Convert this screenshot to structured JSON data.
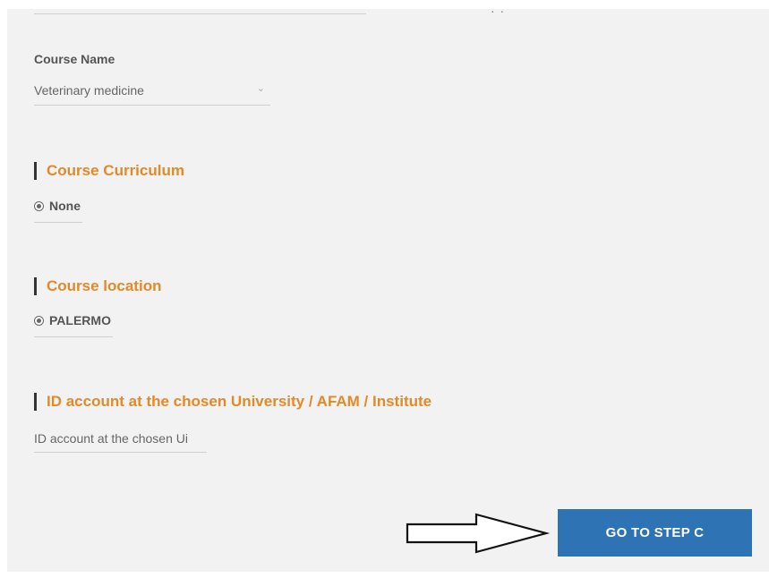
{
  "top": {
    "cutoff_text": "· ·"
  },
  "course_name": {
    "label": "Course Name",
    "selected_value": "Veterinary medicine"
  },
  "course_curriculum": {
    "title": "Course Curriculum",
    "options": [
      {
        "label": "None",
        "selected": true
      }
    ]
  },
  "course_location": {
    "title": "Course location",
    "options": [
      {
        "label": "PALERMO",
        "selected": true
      }
    ]
  },
  "id_account": {
    "title": "ID account at the chosen University / AFAM / Institute",
    "placeholder": "ID account at the chosen Ui"
  },
  "actions": {
    "next_label": "GO TO STEP C"
  },
  "colors": {
    "section_title": "#e08a2a",
    "button": "#2e74b5",
    "panel_bg": "#f2f2f2"
  },
  "icons": {
    "select_chevron": "chevron-down-icon",
    "pointer": "arrow-right-icon"
  }
}
